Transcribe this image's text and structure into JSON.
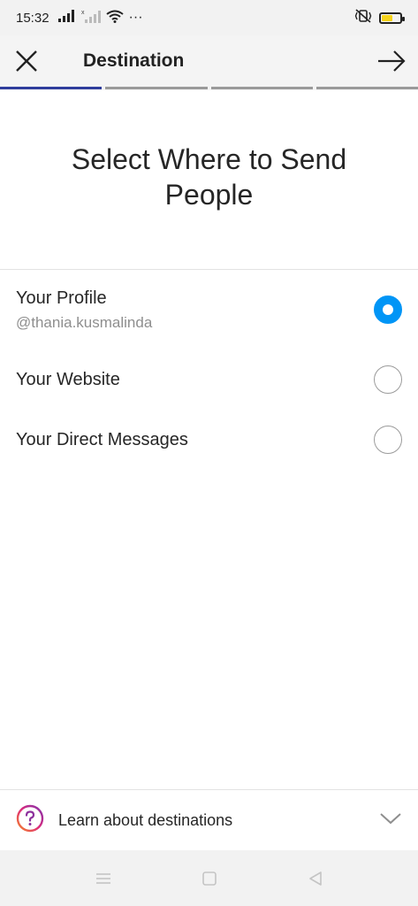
{
  "status_bar": {
    "time": "15:32",
    "overflow": "···",
    "icons": [
      "signal-icon",
      "signal-no-service-icon",
      "wifi-icon",
      "vibrate-icon",
      "battery-icon"
    ],
    "battery_color": "#f5d31a"
  },
  "header": {
    "title": "Destination",
    "close_icon": "close-icon",
    "next_icon": "arrow-right-icon",
    "progress_steps": 4,
    "active_step": 1
  },
  "heading": "Select Where to Send People",
  "options": [
    {
      "label": "Your Profile",
      "sub": "@thania.kusmalinda",
      "selected": true
    },
    {
      "label": "Your Website",
      "sub": "",
      "selected": false
    },
    {
      "label": "Your Direct Messages",
      "sub": "",
      "selected": false
    }
  ],
  "footer": {
    "label": "Learn about destinations",
    "icon": "help-circle-icon",
    "chevron": "chevron-down-icon"
  },
  "colors": {
    "accent": "#0095f6",
    "progress_active": "#2f3d9c",
    "help_gradient_start": "#f58529",
    "help_gradient_end": "#8134af"
  }
}
